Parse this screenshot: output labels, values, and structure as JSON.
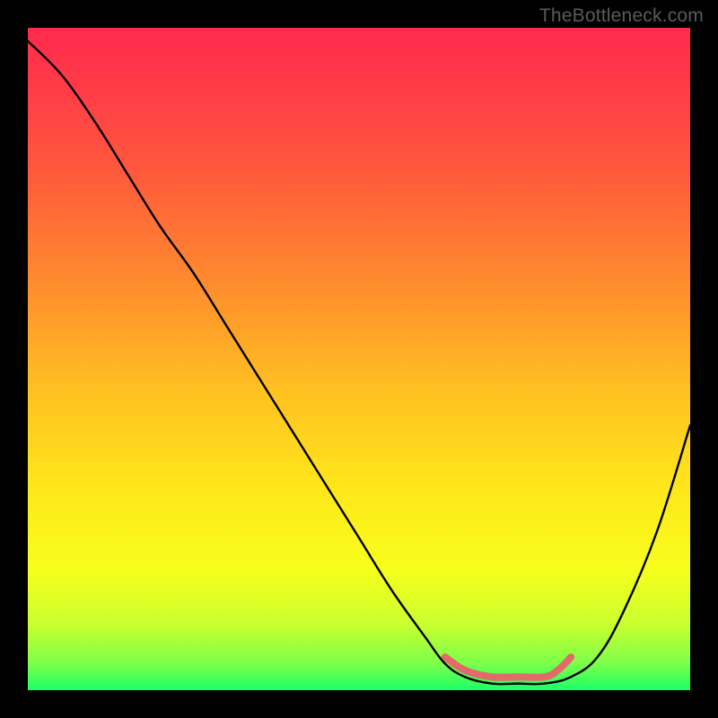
{
  "watermark": "TheBottleneck.com",
  "chart_data": {
    "type": "line",
    "title": "",
    "xlabel": "",
    "ylabel": "",
    "xlim": [
      0,
      100
    ],
    "ylim": [
      0,
      100
    ],
    "gradient_stops": [
      {
        "offset": 0.0,
        "color": "#ff2a4d"
      },
      {
        "offset": 0.1,
        "color": "#ff3d47"
      },
      {
        "offset": 0.22,
        "color": "#ff5a3c"
      },
      {
        "offset": 0.38,
        "color": "#ff8a2e"
      },
      {
        "offset": 0.55,
        "color": "#ffc121"
      },
      {
        "offset": 0.7,
        "color": "#ffe81a"
      },
      {
        "offset": 0.82,
        "color": "#f6ff1c"
      },
      {
        "offset": 0.9,
        "color": "#caff2e"
      },
      {
        "offset": 0.96,
        "color": "#7cff4a"
      },
      {
        "offset": 1.0,
        "color": "#1aff66"
      }
    ],
    "series": [
      {
        "name": "bottleneck-curve",
        "x": [
          0,
          5,
          10,
          15,
          20,
          25,
          30,
          35,
          40,
          45,
          50,
          55,
          60,
          63,
          66,
          70,
          74,
          78,
          82,
          86,
          90,
          95,
          100
        ],
        "y": [
          98,
          93,
          86,
          78,
          70,
          63,
          55,
          47,
          39,
          31,
          23,
          15,
          8,
          4,
          2,
          1,
          1,
          1,
          2,
          5,
          12,
          24,
          40
        ]
      }
    ],
    "highlight": {
      "name": "optimal-band",
      "color": "#e26a6a",
      "x": [
        63,
        66,
        70,
        74,
        78,
        80,
        82
      ],
      "y": [
        5,
        3,
        2,
        2,
        2,
        3,
        5
      ]
    }
  }
}
